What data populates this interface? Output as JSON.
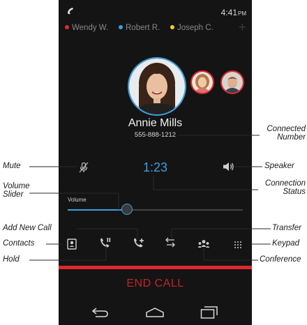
{
  "status_bar": {
    "time": "4:41",
    "ampm": "PM"
  },
  "callers": [
    {
      "name": "Wendy W.",
      "dot_color": "#e8282e"
    },
    {
      "name": "Robert R.",
      "dot_color": "#3aa0e0"
    },
    {
      "name": "Joseph C.",
      "dot_color": "#f0d020"
    }
  ],
  "add_caller_icon": "plus-icon",
  "contact": {
    "name": "Annie Mills",
    "number": "555-888-1212"
  },
  "call": {
    "timer": "1:23"
  },
  "volume": {
    "label": "Volume",
    "level": 0.34
  },
  "controls": {
    "mute_icon": "microphone-muted-icon",
    "speaker_icon": "speaker-icon",
    "add_call_icon": "add-call-icon",
    "transfer_icon": "transfer-icon",
    "contacts_icon": "contacts-card-icon",
    "conference_icon": "conference-people-icon",
    "keypad_icon": "keypad-icon",
    "hold_icon": "hold-call-icon"
  },
  "end_call": {
    "label": "END CALL"
  },
  "nav": {
    "back_icon": "back-icon",
    "home_icon": "home-icon",
    "recents_icon": "recents-icon"
  },
  "annotations": {
    "connected_number": [
      "Connected",
      "Number"
    ],
    "mute": "Mute",
    "speaker": "Speaker",
    "volume_slider": [
      "Volume",
      "Slider"
    ],
    "connection_status": [
      "Connection",
      "Status"
    ],
    "add_new_call": "Add New Call",
    "transfer": "Transfer",
    "contacts": "Contacts",
    "keypad": "Keypad",
    "hold": "Hold",
    "conference": "Conference"
  },
  "colors": {
    "accent": "#3aa0e0",
    "end_call": "#e0262e",
    "background": "#141414"
  }
}
